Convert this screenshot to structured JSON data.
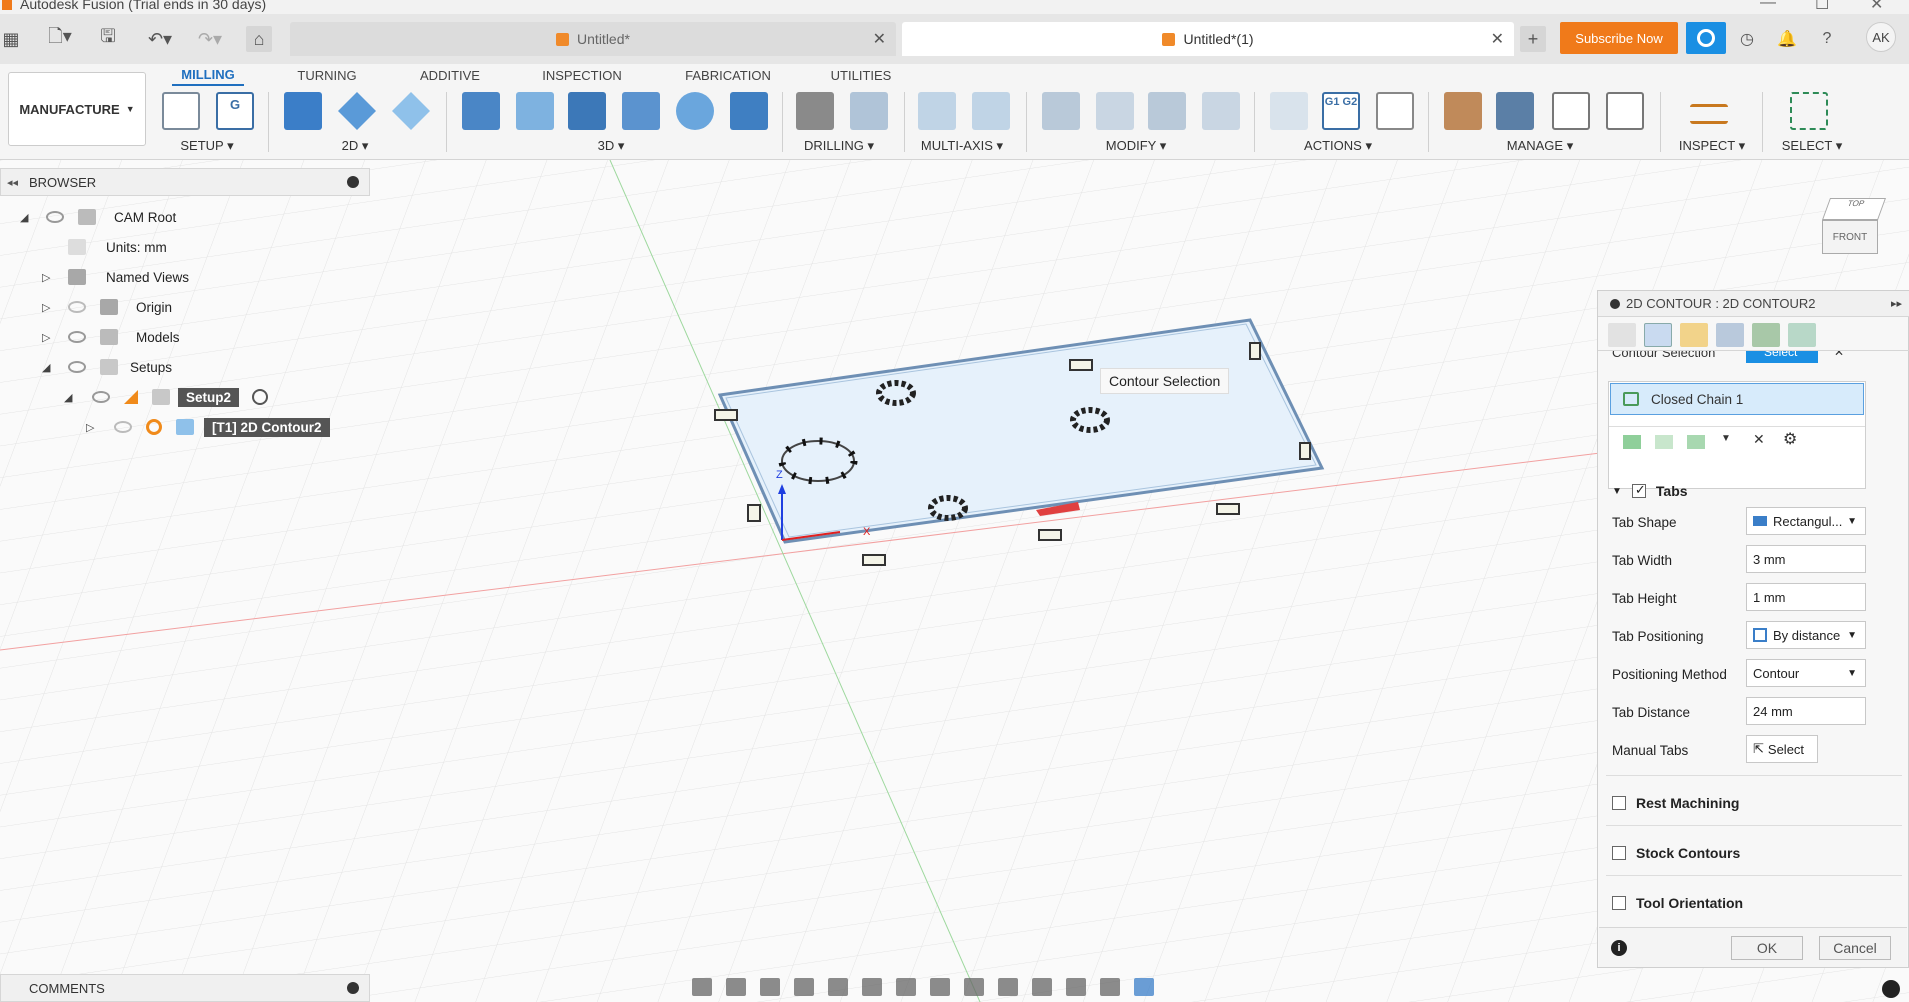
{
  "window": {
    "title": "Autodesk Fusion (Trial ends in 30 days)"
  },
  "tabs": [
    {
      "label": "Untitled*",
      "active": false
    },
    {
      "label": "Untitled*(1)",
      "active": true
    }
  ],
  "topbar": {
    "subscribe_label": "Subscribe Now",
    "avatar_initials": "AK"
  },
  "workspace": {
    "label": "MANUFACTURE"
  },
  "ribbon_tabs": [
    "MILLING",
    "TURNING",
    "ADDITIVE",
    "INSPECTION",
    "FABRICATION",
    "UTILITIES"
  ],
  "ribbon_groups": [
    "SETUP",
    "2D",
    "3D",
    "DRILLING",
    "MULTI-AXIS",
    "MODIFY",
    "ACTIONS",
    "MANAGE",
    "INSPECT",
    "SELECT"
  ],
  "browser": {
    "title": "BROWSER",
    "items": [
      {
        "label": "CAM Root"
      },
      {
        "label": "Units: mm"
      },
      {
        "label": "Named Views"
      },
      {
        "label": "Origin"
      },
      {
        "label": "Models"
      },
      {
        "label": "Setups"
      },
      {
        "label": "Setup2"
      },
      {
        "label": "[T1] 2D Contour2"
      }
    ]
  },
  "viewport": {
    "tooltip": "Contour Selection",
    "viewcube": {
      "top": "TOP",
      "front": "FRONT"
    },
    "axis_labels": {
      "z": "Z",
      "x": "X"
    }
  },
  "panel": {
    "title": "2D CONTOUR : 2D CONTOUR2",
    "contour_selection_label": "Contour Selection",
    "select_label": "Select",
    "chain_item": "Closed Chain 1",
    "tabs_section": "Tabs",
    "rows": [
      {
        "label": "Tab Shape",
        "value": "Rectangul..."
      },
      {
        "label": "Tab Width",
        "value": "3 mm"
      },
      {
        "label": "Tab Height",
        "value": "1 mm"
      },
      {
        "label": "Tab Positioning",
        "value": "By distance"
      },
      {
        "label": "Positioning Method",
        "value": "Contour"
      },
      {
        "label": "Tab Distance",
        "value": "24 mm"
      },
      {
        "label": "Manual Tabs",
        "value": "Select"
      }
    ],
    "sections": [
      "Rest Machining",
      "Stock Contours",
      "Tool Orientation"
    ],
    "ok_label": "OK",
    "cancel_label": "Cancel"
  },
  "comments": {
    "label": "COMMENTS"
  }
}
